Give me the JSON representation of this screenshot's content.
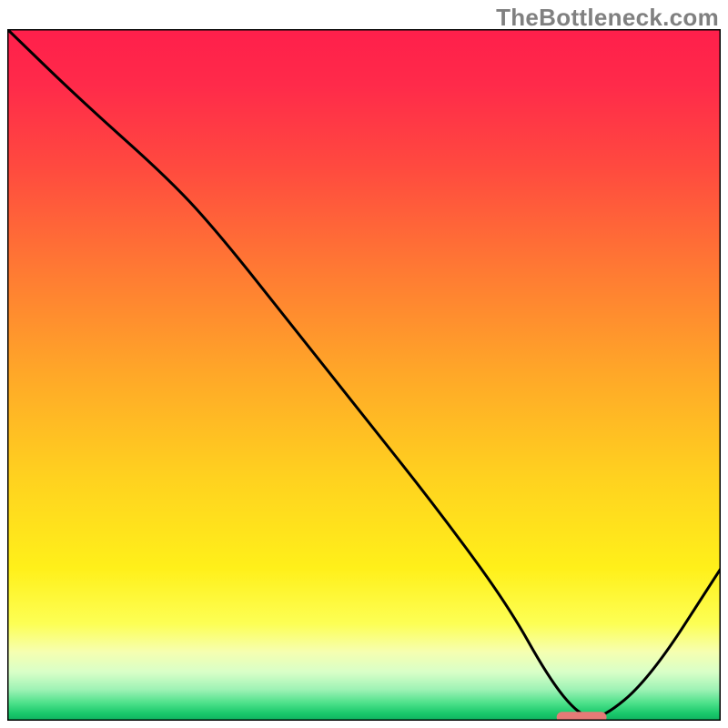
{
  "watermark": "TheBottleneck.com",
  "chart_data": {
    "type": "line",
    "title": "",
    "xlabel": "",
    "ylabel": "",
    "xlim": [
      0,
      100
    ],
    "ylim": [
      0,
      100
    ],
    "grid": false,
    "legend": false,
    "series": [
      {
        "name": "bottleneck-curve",
        "x": [
          0,
          10,
          23,
          30,
          40,
          50,
          60,
          70,
          76,
          80,
          83,
          90,
          100
        ],
        "y": [
          100,
          90,
          78,
          70,
          57,
          44,
          31,
          17,
          6,
          1,
          0,
          6,
          22
        ]
      }
    ],
    "marker": {
      "name": "optimal-range",
      "x_start": 77,
      "x_end": 84,
      "y": 0.5,
      "color": "#e67a77"
    },
    "gradient_stops": [
      {
        "offset": 0.0,
        "color": "#ff1f4b"
      },
      {
        "offset": 0.08,
        "color": "#ff2a4a"
      },
      {
        "offset": 0.2,
        "color": "#ff4a3f"
      },
      {
        "offset": 0.35,
        "color": "#ff7a33"
      },
      {
        "offset": 0.5,
        "color": "#ffa828"
      },
      {
        "offset": 0.65,
        "color": "#ffd21f"
      },
      {
        "offset": 0.78,
        "color": "#fff01a"
      },
      {
        "offset": 0.86,
        "color": "#fdff55"
      },
      {
        "offset": 0.9,
        "color": "#f6ffb0"
      },
      {
        "offset": 0.93,
        "color": "#d8ffc8"
      },
      {
        "offset": 0.955,
        "color": "#9ef2b5"
      },
      {
        "offset": 0.975,
        "color": "#4be089"
      },
      {
        "offset": 0.99,
        "color": "#18c76a"
      },
      {
        "offset": 1.0,
        "color": "#10b060"
      }
    ]
  }
}
